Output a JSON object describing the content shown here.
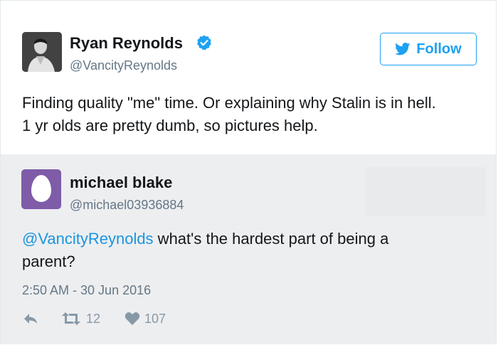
{
  "main_tweet": {
    "author_name": "Ryan Reynolds",
    "handle": "@VancityReynolds",
    "verified": true,
    "follow_label": "Follow",
    "text_lines": [
      "Finding quality \"me\" time. Or explaining why Stalin is in hell.",
      "1 yr olds are pretty dumb, so pictures help."
    ]
  },
  "reply": {
    "author_name": "michael blake",
    "handle": "@michael03936884",
    "mention": "@VancityReynolds",
    "text_rest": " what's the hardest part of being a",
    "text_line2": "parent?",
    "timestamp": "2:50 AM - 30 Jun 2016",
    "retweet_count": "12",
    "like_count": "107"
  },
  "icons": {
    "verified": "verified-badge-icon",
    "follow_bird": "twitter-bird-icon",
    "reply": "reply-arrow-icon",
    "retweet": "retweet-icon",
    "like": "heart-icon"
  },
  "colors": {
    "accent": "#1da1f2",
    "mention": "#1b95e0",
    "muted": "#657786",
    "icon_muted": "#8899a6",
    "reply_background": "#edeef0",
    "egg_avatar": "#7e5ca8"
  }
}
